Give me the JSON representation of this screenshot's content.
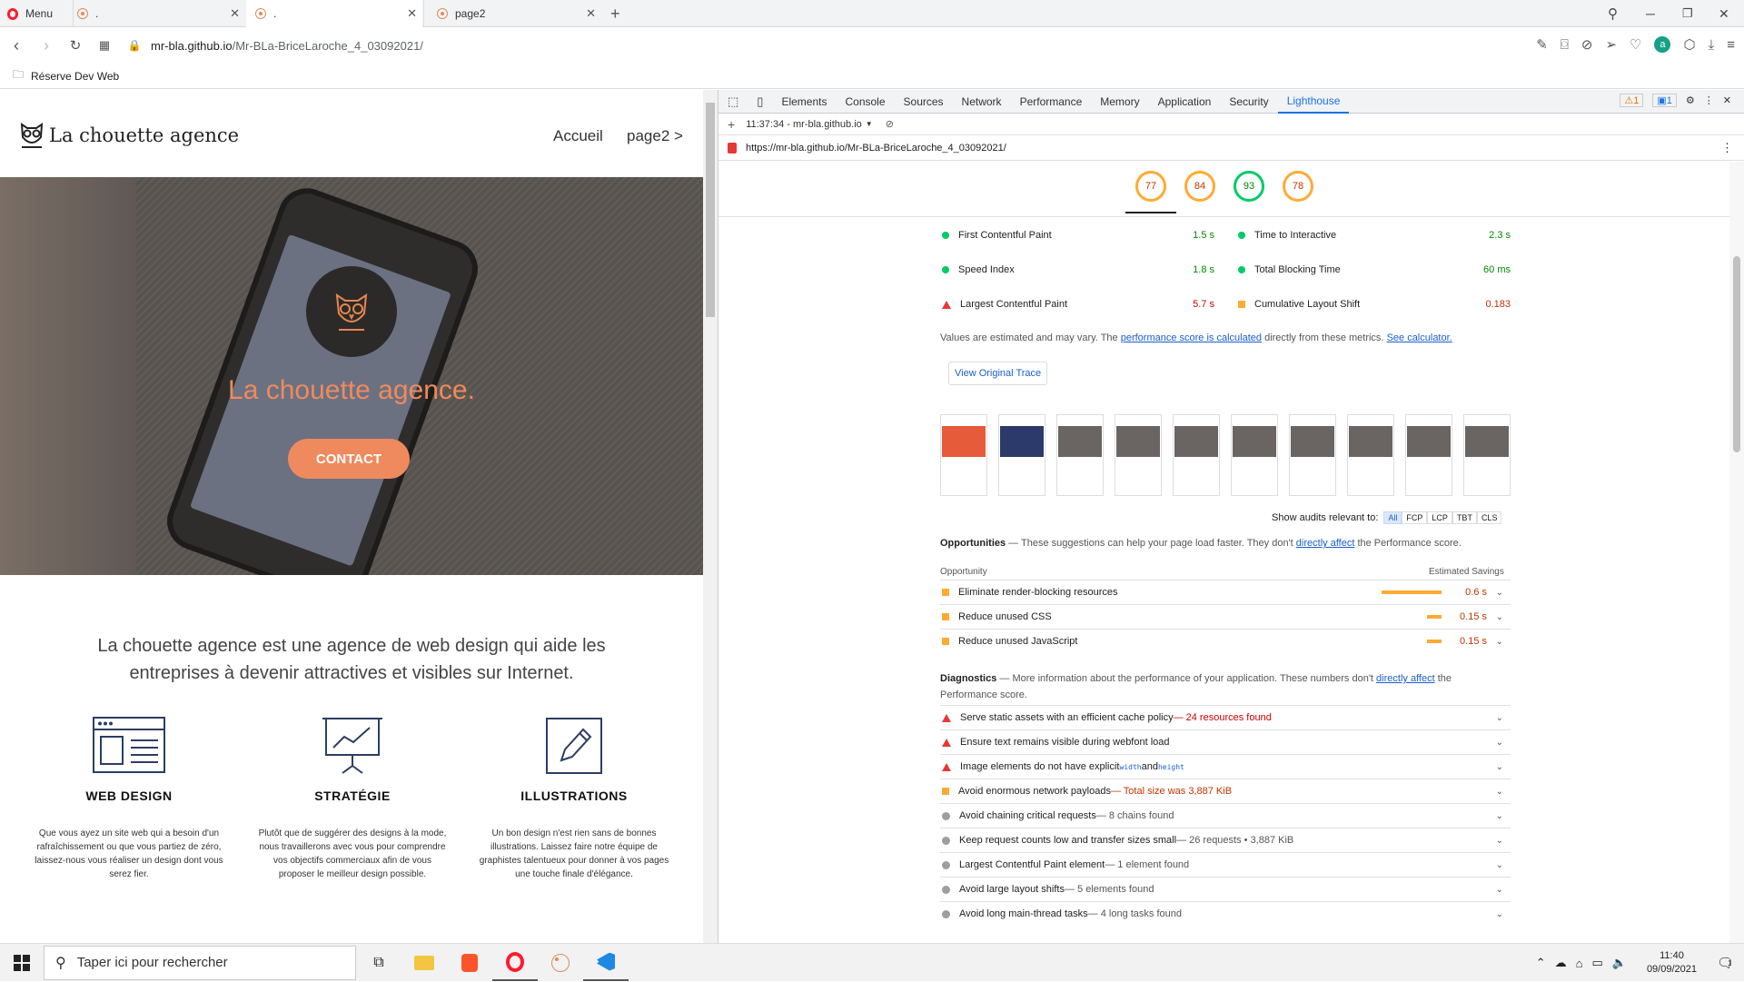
{
  "tabs": [
    {
      "label": "Menu"
    },
    {
      "label": "."
    },
    {
      "label": "."
    },
    {
      "label": "page2"
    }
  ],
  "address": {
    "url_host": "mr-bla.github.io",
    "url_path": "/Mr-BLa-BriceLaroche_4_03092021/"
  },
  "bookmark": {
    "label": "Réserve Dev Web"
  },
  "site": {
    "logo": "La chouette agence",
    "nav": [
      "Accueil",
      "page2 >"
    ],
    "hero_title": "La chouette agence.",
    "hero_button": "CONTACT",
    "intro": "La chouette agence est une agence de web design qui aide les entreprises à devenir attractives et visibles sur Internet.",
    "services": [
      {
        "title": "WEB DESIGN",
        "text": "Que vous ayez un site web qui a besoin d'un rafraîchissement ou que vous partiez de zéro, laissez-nous vous réaliser un design dont vous serez fier."
      },
      {
        "title": "STRATÉGIE",
        "text": "Plutôt que de suggérer des designs à la mode, nous travaillerons avec vous pour comprendre vos objectifs commerciaux afin de vous proposer le meilleur design possible."
      },
      {
        "title": "ILLUSTRATIONS",
        "text": "Un bon design n'est rien sans de bonnes illustrations. Laissez faire notre équipe de graphistes talentueux pour donner à vos pages une touche finale d'élégance."
      }
    ]
  },
  "devtools": {
    "tabs": [
      "Elements",
      "Console",
      "Sources",
      "Network",
      "Performance",
      "Memory",
      "Application",
      "Security",
      "Lighthouse"
    ],
    "warn_count": "1",
    "msg_count": "1",
    "report_time": "11:37:34 - mr-bla.github.io",
    "report_url": "https://mr-bla.github.io/Mr-BLa-BriceLaroche_4_03092021/",
    "scores": [
      "77",
      "84",
      "93",
      "78"
    ],
    "metrics": [
      {
        "label": "First Contentful Paint",
        "value": "1.5 s",
        "status": "pass"
      },
      {
        "label": "Time to Interactive",
        "value": "2.3 s",
        "status": "pass"
      },
      {
        "label": "Speed Index",
        "value": "1.8 s",
        "status": "pass"
      },
      {
        "label": "Total Blocking Time",
        "value": "60 ms",
        "status": "pass"
      },
      {
        "label": "Largest Contentful Paint",
        "value": "5.7 s",
        "status": "fail"
      },
      {
        "label": "Cumulative Layout Shift",
        "value": "0.183",
        "status": "average"
      }
    ],
    "note_prefix": "Values are estimated and may vary. The ",
    "note_link1": "performance score is calculated",
    "note_mid": " directly from these metrics. ",
    "note_link2": "See calculator.",
    "view_trace": "View Original Trace",
    "show_audits": "Show audits relevant to:",
    "filters": [
      "All",
      "FCP",
      "LCP",
      "TBT",
      "CLS"
    ],
    "opps_title": "Opportunities",
    "opps_desc": " — These suggestions can help your page load faster. They don't ",
    "opps_link": "directly affect",
    "opps_tail": " the Performance score.",
    "opp_col": "Opportunity",
    "savings_col": "Estimated Savings",
    "opportunities": [
      {
        "label": "Eliminate render-blocking resources",
        "value": "0.6 s"
      },
      {
        "label": "Reduce unused CSS",
        "value": "0.15 s"
      },
      {
        "label": "Reduce unused JavaScript",
        "value": "0.15 s"
      }
    ],
    "diag_title": "Diagnostics",
    "diag_desc": " — More information about the performance of your application. These numbers don't ",
    "diag_link": "directly affect",
    "diag_tail": " the",
    "diag_tail2": "Performance score.",
    "diagnostics": [
      {
        "label": "Serve static assets with an efficient cache policy",
        "detail": " — 24 resources found",
        "kind": "fail"
      },
      {
        "label": "Ensure text remains visible during webfont load",
        "detail": "",
        "kind": "fail"
      },
      {
        "label": "Image elements do not have explicit ",
        "code1": "width",
        "and": " and ",
        "code2": "height",
        "kind": "fail"
      },
      {
        "label": "Avoid enormous network payloads",
        "detail": " — Total size was 3,887 KiB",
        "kind": "average"
      },
      {
        "label": "Avoid chaining critical requests",
        "detail": " — 8 chains found",
        "kind": "info"
      },
      {
        "label": "Keep request counts low and transfer sizes small",
        "detail": " — 26 requests • 3,887 KiB",
        "kind": "info"
      },
      {
        "label": "Largest Contentful Paint element",
        "detail": " — 1 element found",
        "kind": "info"
      },
      {
        "label": "Avoid large layout shifts",
        "detail": " — 5 elements found",
        "kind": "info"
      },
      {
        "label": "Avoid long main-thread tasks",
        "detail": " — 4 long tasks found",
        "kind": "info"
      }
    ]
  },
  "taskbar": {
    "search": "Taper ici pour rechercher",
    "time": "11:40",
    "date": "09/09/2021",
    "notif": "1"
  }
}
